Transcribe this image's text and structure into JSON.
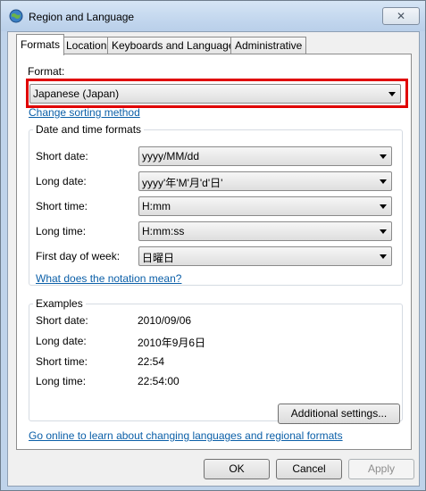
{
  "window": {
    "title": "Region and Language",
    "close_glyph": "✕"
  },
  "tabs": [
    "Formats",
    "Location",
    "Keyboards and Languages",
    "Administrative"
  ],
  "format": {
    "label": "Format:",
    "value": "Japanese (Japan)",
    "sorting_link": "Change sorting method"
  },
  "date_time": {
    "group_title": "Date and time formats",
    "rows": [
      {
        "label": "Short date:",
        "value": "yyyy/MM/dd"
      },
      {
        "label": "Long date:",
        "value": "yyyy'年'M'月'd'日'"
      },
      {
        "label": "Short time:",
        "value": "H:mm"
      },
      {
        "label": "Long time:",
        "value": "H:mm:ss"
      },
      {
        "label": "First day of week:",
        "value": "日曜日"
      }
    ],
    "notation_link": "What does the notation mean?"
  },
  "examples": {
    "group_title": "Examples",
    "rows": [
      {
        "label": "Short date:",
        "value": "2010/09/06"
      },
      {
        "label": "Long date:",
        "value": "2010年9月6日"
      },
      {
        "label": "Short time:",
        "value": "22:54"
      },
      {
        "label": "Long time:",
        "value": "22:54:00"
      }
    ]
  },
  "additional_settings": "Additional settings...",
  "online_link": "Go online to learn about changing languages and regional formats",
  "buttons": {
    "ok": "OK",
    "cancel": "Cancel",
    "apply": "Apply"
  },
  "colors": {
    "link": "#0b5fa8",
    "highlight": "#e00000"
  }
}
